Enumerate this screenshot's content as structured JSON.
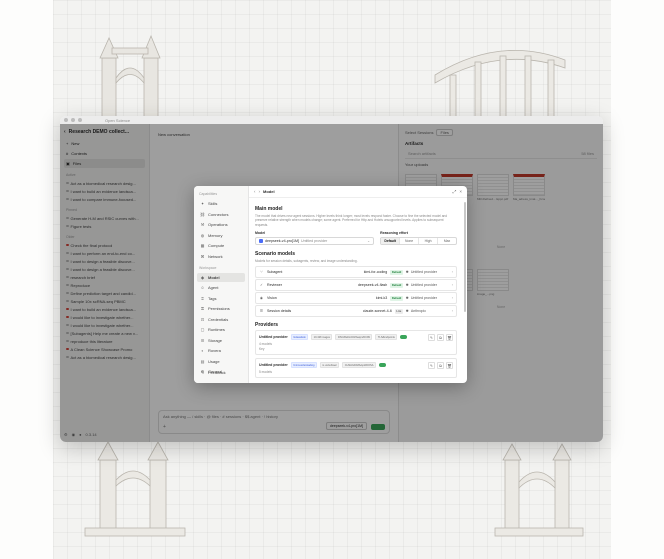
{
  "window": {
    "title": "Open Science"
  },
  "sidebar": {
    "project": "Research DEMO collect...",
    "nav": [
      {
        "icon": "plus-icon",
        "label": "New"
      },
      {
        "icon": "hash-icon",
        "label": "Contexts"
      },
      {
        "icon": "folder-icon",
        "label": "Files"
      }
    ],
    "sections": [
      {
        "label": "Active",
        "items": [
          {
            "label": "Act as a biomedical research desig...",
            "dot": "grey"
          },
          {
            "label": "I want to build an evidence landsca...",
            "dot": "grey"
          },
          {
            "label": "I want to compare immune-focused...",
            "dot": "grey"
          }
        ]
      },
      {
        "label": "Pinned",
        "items": [
          {
            "label": "Generate H-M and RSIC curves with...",
            "dot": "grey"
          },
          {
            "label": "Figure tests",
            "dot": "grey"
          }
        ]
      },
      {
        "label": "Older",
        "items": [
          {
            "label": "Check the final protocol",
            "dot": "red"
          },
          {
            "label": "I want to perform an end-to-end co...",
            "dot": "grey"
          },
          {
            "label": "I want to design a feasible discove...",
            "dot": "grey"
          },
          {
            "label": "I want to design a feasible discove...",
            "dot": "grey"
          },
          {
            "label": "research brief",
            "dot": "grey"
          },
          {
            "label": "Reproduce",
            "dot": "grey"
          },
          {
            "label": "Define prediction target and candid...",
            "dot": "grey"
          },
          {
            "label": "Sample 10x scRNA-seq PBMC",
            "dot": "grey"
          },
          {
            "label": "I want to build an evidence landsca...",
            "dot": "red"
          },
          {
            "label": "I would like to investigate whether...",
            "dot": "red"
          },
          {
            "label": "I would like to investigate whether...",
            "dot": "grey"
          },
          {
            "label": "[Subagents] Help me create a new v...",
            "dot": "grey"
          },
          {
            "label": "reproduce this literature",
            "dot": "grey"
          },
          {
            "label": "A Clean Science Showcase Promo",
            "dot": "red"
          },
          {
            "label": "Act as a biomedical research desig...",
            "dot": "grey"
          }
        ]
      }
    ],
    "footer_version": "0.3.14"
  },
  "main": {
    "title": "New conversation",
    "composer_placeholder": "Ask anything — / skills · @ files · # sessions · $$ agent · ! history",
    "composer_model": "deepseek-v4-pro[1M]"
  },
  "right_panel": {
    "top_label": "Select Sessions",
    "tab": "Files",
    "artifacts_label": "Artifacts",
    "search_placeholder": "Search artifacts",
    "search_count": "58 files",
    "your_uploads": "Your uploads",
    "thumbs_row1": [
      "Definitions... Fcode.pdf",
      "pdf_definitions...pdf",
      "MR-Refined... Eppc.pdf",
      "Ma_adress_tmat..._Fcode.pdf"
    ],
    "thumbs_row2": [
      "Fig_sub_2_2ns...pdf"
    ],
    "section_composer": "... Composer",
    "thumbs_row3": [
      "blank_p.png",
      "blank_2.png",
      "image_...png"
    ],
    "section_pbmc": "Sample 10x scRNA-seq PBMC",
    "none_label": "None"
  },
  "modal": {
    "nav_groups": [
      {
        "label": "Capabilities",
        "items": [
          {
            "icon": "sparkle-icon",
            "label": "Skills"
          },
          {
            "icon": "link-icon",
            "label": "Connectors"
          },
          {
            "icon": "wrench-icon",
            "label": "Operations"
          },
          {
            "icon": "brain-icon",
            "label": "Memory"
          },
          {
            "icon": "cpu-icon",
            "label": "Compute"
          },
          {
            "icon": "network-icon",
            "label": "Network"
          }
        ]
      },
      {
        "label": "Workspace",
        "items": [
          {
            "icon": "model-icon",
            "label": "Model",
            "active": true
          },
          {
            "icon": "agent-icon",
            "label": "Agent"
          },
          {
            "icon": "tag-icon",
            "label": "Tags"
          },
          {
            "icon": "key-icon",
            "label": "Permissions"
          },
          {
            "icon": "lock-icon",
            "label": "Credentials"
          },
          {
            "icon": "box-icon",
            "label": "Runtimes"
          },
          {
            "icon": "database-icon",
            "label": "Storage"
          },
          {
            "icon": "palette-icon",
            "label": "Rovera"
          },
          {
            "icon": "chart-icon",
            "label": "Usage"
          },
          {
            "icon": "gear-icon",
            "label": "General"
          }
        ]
      }
    ],
    "feedback": "Feedback",
    "header": {
      "crumb": "Model"
    },
    "main_model": {
      "heading": "Main model",
      "description": "The model that drives new agent sessions. Higher levels think longer; most levels respond faster. Choose to fine the selected model and preserve relative strength when models change; some agent. Preferred for Http and Hotels unsupported levels. Applies to subsequent requests.",
      "model_label": "Model",
      "model_value": "deepseek-v4-pro[1M]",
      "model_provider": "Untitled provider",
      "effort_label": "Reasoning effort",
      "effort_options": [
        "Default",
        "None",
        "High",
        "Max"
      ],
      "effort_selected": "Default"
    },
    "scenario": {
      "heading": "Scenario models",
      "description": "Models for session details, subagents, review, and image understanding.",
      "rows": [
        {
          "icon": "subagent-icon",
          "name": "Subagent",
          "model": "kimi-for-coding",
          "badge": "Default",
          "provider": "Untitled provider"
        },
        {
          "icon": "review-icon",
          "name": "Reviewer",
          "model": "deepseek-v4-flash",
          "badge": "Default",
          "provider": "Untitled provider"
        },
        {
          "icon": "eye-icon",
          "name": "Vision",
          "model": "kimi-k3",
          "badge": "Default",
          "provider": "Untitled provider"
        },
        {
          "icon": "details-icon",
          "name": "Session details",
          "model": "claude-sonnet-4-6",
          "badge": "Lite",
          "provider": "Anthropic"
        }
      ]
    },
    "providers": {
      "heading": "Providers",
      "cards": [
        {
          "name": "Untitled provider",
          "chips": [
            "Gdeasfesk",
            "10.4M images",
            "DSC/ReDoCD/Ibaqm/DC99",
            "TLS/Endpoints"
          ],
          "sub1": "4 models",
          "sub2": "Key"
        },
        {
          "name": "Untitled provider",
          "chips": [
            "Unimuscle/stadiog",
            "is vertebrae/",
            "CLMAGD/MA/spd/DOSA"
          ],
          "sub1": "5 models",
          "sub2": ""
        }
      ]
    }
  }
}
